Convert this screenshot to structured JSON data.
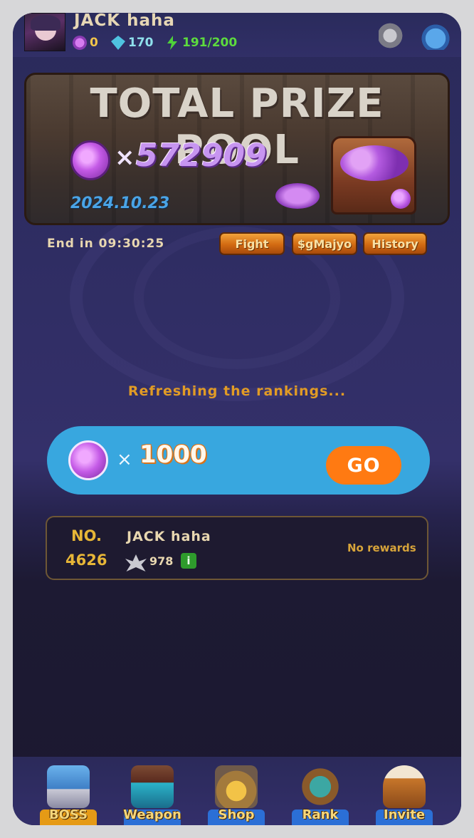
{
  "player": {
    "name": "JACK haha",
    "gems": "0",
    "diamonds": "170",
    "energy": "191/200"
  },
  "prize_pool": {
    "title": "TOTAL PRIZE POOL",
    "multiplier": "×",
    "amount": "572909",
    "date": "2024.10.23"
  },
  "timer": {
    "label": "End in 09:30:25"
  },
  "buttons": {
    "fight": "Fight",
    "majyo": "$gMajyo",
    "history": "History"
  },
  "status": {
    "refreshing": "Refreshing the rankings..."
  },
  "bet": {
    "multiplier": "×",
    "amount": "1000",
    "go_label": "GO"
  },
  "my_rank": {
    "no_label": "NO.",
    "rank": "4626",
    "name": "JACK haha",
    "score": "978",
    "info": "i",
    "rewards": "No rewards"
  },
  "nav": {
    "items": [
      {
        "label": "BOSS",
        "active": true
      },
      {
        "label": "Weapon",
        "active": false
      },
      {
        "label": "Shop",
        "active": false
      },
      {
        "label": "Rank",
        "active": false
      },
      {
        "label": "Invite",
        "active": false
      }
    ]
  },
  "icons": {
    "gem": "purple-gem-icon",
    "diamond": "blue-diamond-icon",
    "energy": "green-lightning-icon",
    "sound": "speaker-icon",
    "bag": "potion-bag-icon",
    "coin": "purple-coin-icon",
    "rank_badge": "winged-badge-icon",
    "info": "info-icon"
  },
  "colors": {
    "accent_orange": "#ff7a12",
    "bet_bar": "#38a7df",
    "gold_text": "#e7b637"
  }
}
